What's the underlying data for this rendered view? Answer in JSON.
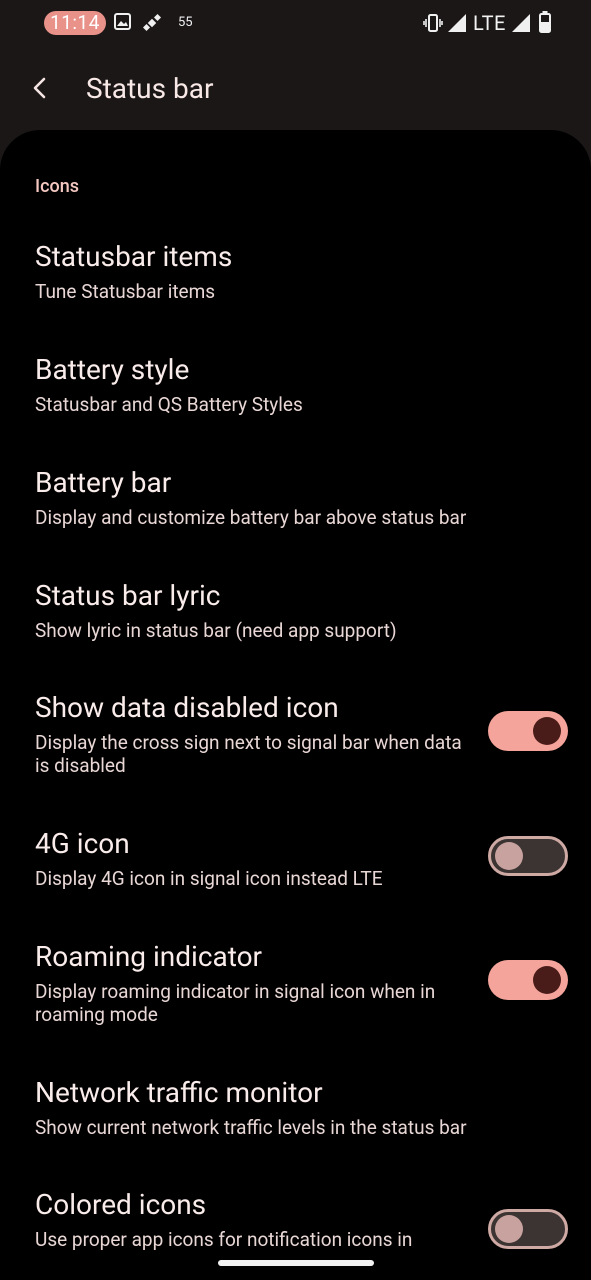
{
  "status_bar": {
    "time": "11:14",
    "notification_count": "55",
    "network": "LTE",
    "icons": [
      "image-icon",
      "satellite-icon",
      "vibrate-icon",
      "signal-icon",
      "signal-icon",
      "battery-icon"
    ]
  },
  "app_bar": {
    "title": "Status bar",
    "back_icon": "back-arrow-icon"
  },
  "section": {
    "header": "Icons"
  },
  "settings": [
    {
      "title": "Statusbar items",
      "subtitle": "Tune Statusbar items"
    },
    {
      "title": "Battery style",
      "subtitle": "Statusbar and QS Battery Styles"
    },
    {
      "title": "Battery bar",
      "subtitle": "Display and customize battery bar above status bar"
    },
    {
      "title": "Status bar lyric",
      "subtitle": "Show lyric in status bar (need app support)"
    },
    {
      "title": "Show data disabled icon",
      "subtitle": "Display the cross sign next to signal bar when data is disabled",
      "toggle": true
    },
    {
      "title": "4G icon",
      "subtitle": "Display 4G icon in signal icon instead LTE",
      "toggle": false
    },
    {
      "title": "Roaming indicator",
      "subtitle": "Display roaming indicator in signal icon when in roaming mode",
      "toggle": true
    },
    {
      "title": "Network traffic monitor",
      "subtitle": "Show current network traffic levels in the status bar"
    },
    {
      "title": "Colored icons",
      "subtitle": "Use proper app icons for notification icons in",
      "toggle": false
    }
  ],
  "colors": {
    "accent": "#f5a49b",
    "thumb_on": "#4a1c19",
    "background": "#000000",
    "clock_pill": "#e9928a"
  }
}
